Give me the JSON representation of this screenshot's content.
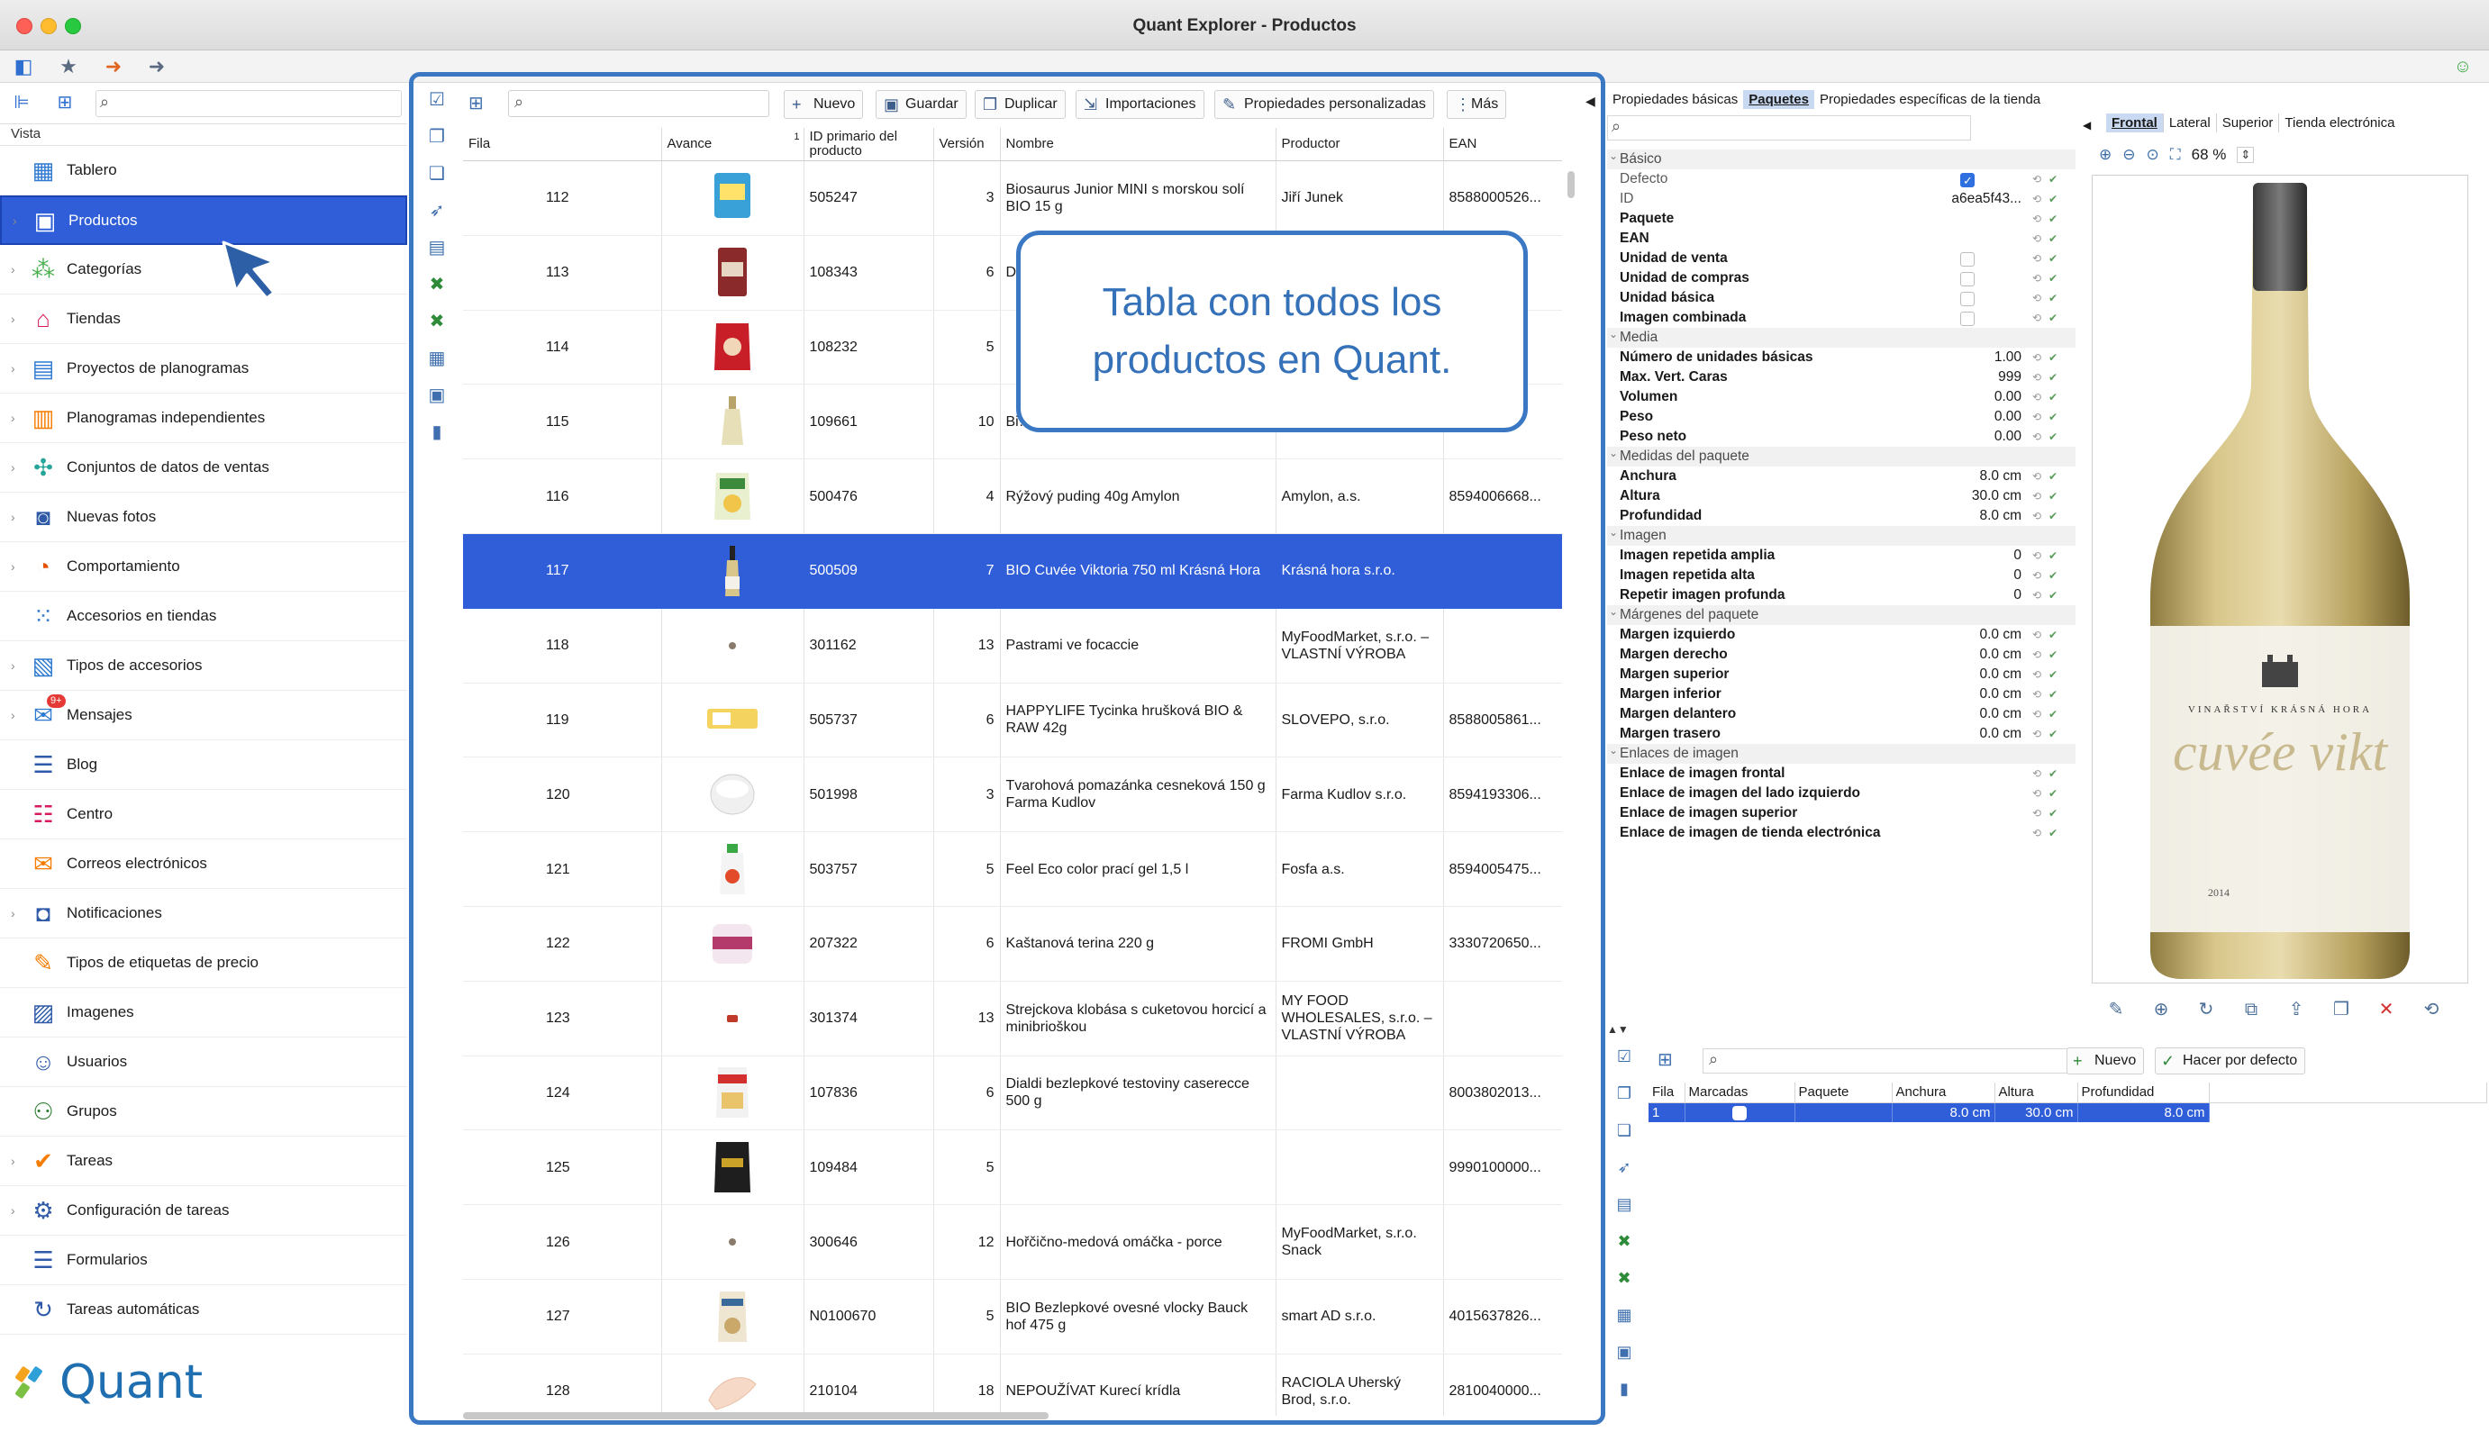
{
  "window": {
    "title": "Quant Explorer - Productos"
  },
  "nav": {
    "view_label": "Vista",
    "items": [
      {
        "label": "Tablero",
        "icon": "dashboard-icon",
        "glyph": "▦",
        "color": "#2f7ad0",
        "expandable": false
      },
      {
        "label": "Productos",
        "icon": "product-box-icon",
        "glyph": "▣",
        "color": "#ffffff",
        "expandable": true,
        "selected": true
      },
      {
        "label": "Categorías",
        "icon": "categories-icon",
        "glyph": "⁂",
        "color": "#4caf50",
        "expandable": true
      },
      {
        "label": "Tiendas",
        "icon": "store-icon",
        "glyph": "⌂",
        "color": "#d81b60",
        "expandable": true
      },
      {
        "label": "Proyectos de planogramas",
        "icon": "planogram-project-icon",
        "glyph": "▤",
        "color": "#2f7ad0",
        "expandable": true
      },
      {
        "label": "Planogramas independientes",
        "icon": "planogram-icon",
        "glyph": "▥",
        "color": "#f57c00",
        "expandable": true
      },
      {
        "label": "Conjuntos de datos de ventas",
        "icon": "sales-data-icon",
        "glyph": "✣",
        "color": "#26a69a",
        "expandable": true
      },
      {
        "label": "Nuevas fotos",
        "icon": "camera-icon",
        "glyph": "◙",
        "color": "#2f5aa8",
        "expandable": true
      },
      {
        "label": "Comportamiento",
        "icon": "behavior-icon",
        "glyph": "◔",
        "color": "#e65100",
        "expandable": true
      },
      {
        "label": "Accesorios en tiendas",
        "icon": "store-accessories-icon",
        "glyph": "⁙",
        "color": "#2f7ad0",
        "expandable": false
      },
      {
        "label": "Tipos de accesorios",
        "icon": "accessory-types-icon",
        "glyph": "▧",
        "color": "#2f7ad0",
        "expandable": true
      },
      {
        "label": "Mensajes",
        "icon": "messages-icon",
        "glyph": "✉",
        "color": "#2f7ad0",
        "expandable": true,
        "badge": "9+"
      },
      {
        "label": "Blog",
        "icon": "blog-icon",
        "glyph": "☰",
        "color": "#2f5aa8",
        "expandable": false
      },
      {
        "label": "Centro",
        "icon": "center-icon",
        "glyph": "☷",
        "color": "#d81b60",
        "expandable": false
      },
      {
        "label": "Correos electrónicos",
        "icon": "email-icon",
        "glyph": "✉",
        "color": "#f57c00",
        "expandable": false
      },
      {
        "label": "Notificaciones",
        "icon": "notifications-icon",
        "glyph": "◘",
        "color": "#2f5aa8",
        "expandable": true
      },
      {
        "label": "Tipos de etiquetas de precio",
        "icon": "price-tag-icon",
        "glyph": "✎",
        "color": "#f57c00",
        "expandable": false
      },
      {
        "label": "Imagenes",
        "icon": "images-icon",
        "glyph": "▨",
        "color": "#2f5aa8",
        "expandable": false
      },
      {
        "label": "Usuarios",
        "icon": "users-icon",
        "glyph": "☺",
        "color": "#2f5aa8",
        "expandable": false
      },
      {
        "label": "Grupos",
        "icon": "groups-icon",
        "glyph": "⚇",
        "color": "#2e7d32",
        "expandable": false
      },
      {
        "label": "Tareas",
        "icon": "tasks-icon",
        "glyph": "✔",
        "color": "#f57c00",
        "expandable": true
      },
      {
        "label": "Configuración de tareas",
        "icon": "task-config-icon",
        "glyph": "⚙",
        "color": "#2f5aa8",
        "expandable": true
      },
      {
        "label": "Formularios",
        "icon": "forms-icon",
        "glyph": "☰",
        "color": "#2f5aa8",
        "expandable": false
      },
      {
        "label": "Tareas automáticas",
        "icon": "automatic-tasks-icon",
        "glyph": "↻",
        "color": "#2f5aa8",
        "expandable": false
      }
    ],
    "logo_text": "Quant"
  },
  "grid": {
    "toolbar": {
      "new_label": "Nuevo",
      "save_label": "Guardar",
      "duplicate_label": "Duplicar",
      "imports_label": "Importaciones",
      "custom_props_label": "Propiedades personalizadas",
      "more_label": "Más"
    },
    "columns": [
      "Fila",
      "Avance",
      "ID primario del producto",
      "Versión",
      "Nombre",
      "Productor",
      "EAN"
    ],
    "sort_indicator": "1",
    "rows": [
      {
        "fila": "112",
        "id": "505247",
        "ver": "3",
        "name": "Biosaurus Junior MINI s morskou solí BIO 15 g",
        "producer": "Jiří Junek",
        "ean": "8588000526...",
        "thumb": "chips-bag"
      },
      {
        "fila": "113",
        "id": "108343",
        "ver": "6",
        "name": "D… 2…",
        "producer": "",
        "ean": "…02...",
        "thumb": "pack-red"
      },
      {
        "fila": "114",
        "id": "108232",
        "ver": "5",
        "name": "",
        "producer": "",
        "ean": "…14...",
        "thumb": "bag-red"
      },
      {
        "fila": "115",
        "id": "109661",
        "ver": "10",
        "name": "Bi…",
        "producer": "",
        "ean": "…02...",
        "thumb": "bottle-clear"
      },
      {
        "fila": "116",
        "id": "500476",
        "ver": "4",
        "name": "Rýžový puding 40g Amylon",
        "producer": "Amylon, a.s.",
        "ean": "8594006668...",
        "thumb": "bag-green"
      },
      {
        "fila": "117",
        "id": "500509",
        "ver": "7",
        "name": "BIO Cuvée Viktoria 750 ml Krásná Hora",
        "producer": "Krásná hora s.r.o.",
        "ean": "",
        "thumb": "wine-bottle",
        "selected": true
      },
      {
        "fila": "118",
        "id": "301162",
        "ver": "13",
        "name": "Pastrami ve focaccie",
        "producer": "MyFoodMarket, s.r.o. – VLASTNÍ VÝROBA",
        "ean": "",
        "thumb": "dot"
      },
      {
        "fila": "119",
        "id": "505737",
        "ver": "6",
        "name": "HAPPYLIFE Tycinka hrušková BIO & RAW 42g",
        "producer": "SLOVEPO, s.r.o.",
        "ean": "8588005861...",
        "thumb": "bar-yellow"
      },
      {
        "fila": "120",
        "id": "501998",
        "ver": "3",
        "name": "Tvarohová pomazánka cesneková 150 g Farma Kudlov",
        "producer": "Farma Kudlov s.r.o.",
        "ean": "8594193306...",
        "thumb": "cup-white"
      },
      {
        "fila": "121",
        "id": "503757",
        "ver": "5",
        "name": "Feel Eco color prací gel 1,5 l",
        "producer": "Fosfa a.s.",
        "ean": "8594005475...",
        "thumb": "bottle-green"
      },
      {
        "fila": "122",
        "id": "207322",
        "ver": "6",
        "name": "Kaštanová terina 220 g",
        "producer": "FROMI GmbH",
        "ean": "3330720650...",
        "thumb": "jar-pink"
      },
      {
        "fila": "123",
        "id": "301374",
        "ver": "13",
        "name": "Strejckova klobása  s cuketovou horcicí a minibrioškou",
        "producer": "MY FOOD WHOLESALES, s.r.o. – VLASTNÍ VÝROBA",
        "ean": "",
        "thumb": "dot-red"
      },
      {
        "fila": "124",
        "id": "107836",
        "ver": "6",
        "name": "Dialdi bezlepkové testoviny caserecce 500 g",
        "producer": "",
        "ean": "8003802013...",
        "thumb": "bag-pasta"
      },
      {
        "fila": "125",
        "id": "109484",
        "ver": "5",
        "name": "",
        "producer": "",
        "ean": "9990100000...",
        "thumb": "bag-black"
      },
      {
        "fila": "126",
        "id": "300646",
        "ver": "12",
        "name": "Hořčično-medová omáčka - porce",
        "producer": "MyFoodMarket, s.r.o. Snack",
        "ean": "",
        "thumb": "dot"
      },
      {
        "fila": "127",
        "id": "N0100670",
        "ver": "5",
        "name": "BIO Bezlepkové ovesné vlocky Bauck hof 475 g",
        "producer": "smart AD s.r.o.",
        "ean": "4015637826...",
        "thumb": "bag-oat"
      },
      {
        "fila": "128",
        "id": "210104",
        "ver": "18",
        "name": "NEPOUŽÍVAT Kurecí krídla",
        "producer": "RACIOLA Uherský Brod, s.r.o.",
        "ean": "2810040000...",
        "thumb": "chicken"
      }
    ]
  },
  "callout": {
    "line1": "Tabla con todos los",
    "line2": "productos en Quant."
  },
  "props": {
    "tabs": [
      "Propiedades básicas",
      "Paquetes",
      "Propiedades específicas de la tienda"
    ],
    "rows": [
      {
        "type": "sec",
        "label": "Básico"
      },
      {
        "label": "Defecto",
        "check": "on",
        "gray": true
      },
      {
        "label": "ID",
        "value": "a6ea5f43...",
        "gray": true
      },
      {
        "label": "Paquete"
      },
      {
        "label": "EAN"
      },
      {
        "label": "Unidad de venta",
        "check": "off"
      },
      {
        "label": "Unidad de compras",
        "check": "off"
      },
      {
        "label": "Unidad básica",
        "check": "off"
      },
      {
        "label": "Imagen combinada",
        "check": "off"
      },
      {
        "type": "sec",
        "label": "Media"
      },
      {
        "label": "Número de unidades básicas",
        "value": "1.00"
      },
      {
        "label": "Max. Vert. Caras",
        "value": "999"
      },
      {
        "label": "Volumen",
        "value": "0.00"
      },
      {
        "label": "Peso",
        "value": "0.00"
      },
      {
        "label": "Peso neto",
        "value": "0.00"
      },
      {
        "type": "sec",
        "label": "Medidas del paquete"
      },
      {
        "label": "Anchura",
        "value": "8.0 cm"
      },
      {
        "label": "Altura",
        "value": "30.0 cm"
      },
      {
        "label": "Profundidad",
        "value": "8.0 cm"
      },
      {
        "type": "sec",
        "label": "Imagen"
      },
      {
        "label": "Imagen repetida amplia",
        "value": "0"
      },
      {
        "label": "Imagen repetida alta",
        "value": "0"
      },
      {
        "label": "Repetir imagen profunda",
        "value": "0"
      },
      {
        "type": "sec",
        "label": "Márgenes del paquete"
      },
      {
        "label": "Margen izquierdo",
        "value": "0.0 cm"
      },
      {
        "label": "Margen derecho",
        "value": "0.0 cm"
      },
      {
        "label": "Margen superior",
        "value": "0.0 cm"
      },
      {
        "label": "Margen inferior",
        "value": "0.0 cm"
      },
      {
        "label": "Margen delantero",
        "value": "0.0 cm"
      },
      {
        "label": "Margen trasero",
        "value": "0.0 cm"
      },
      {
        "type": "sec",
        "label": "Enlaces de imagen"
      },
      {
        "label": "Enlace de imagen frontal"
      },
      {
        "label": "Enlace de imagen del lado izquierdo"
      },
      {
        "label": "Enlace de imagen superior"
      },
      {
        "label": "Enlace de imagen de tienda electrónica"
      }
    ]
  },
  "viewer": {
    "tabs": [
      "Frontal",
      "Lateral",
      "Superior",
      "Tienda electrónica"
    ],
    "zoom": "68 %",
    "label_brand": "VINAŘSTVÍ KRÁSNÁ HORA",
    "label_name": "cuvée vikt",
    "label_year": "2014"
  },
  "packages": {
    "new_label": "Nuevo",
    "default_label": "Hacer por defecto",
    "columns": [
      "Fila",
      "Marcadas",
      "Paquete",
      "Anchura",
      "Altura",
      "Profundidad"
    ],
    "rows": [
      {
        "fila": "1",
        "paquete": "",
        "anchura": "8.0 cm",
        "altura": "30.0 cm",
        "profundidad": "8.0 cm"
      }
    ]
  },
  "colors": {
    "accent": "#2f5ed8",
    "frame": "#3b78c4",
    "callout_text": "#3471b8",
    "logo": "#1f6fb0"
  }
}
